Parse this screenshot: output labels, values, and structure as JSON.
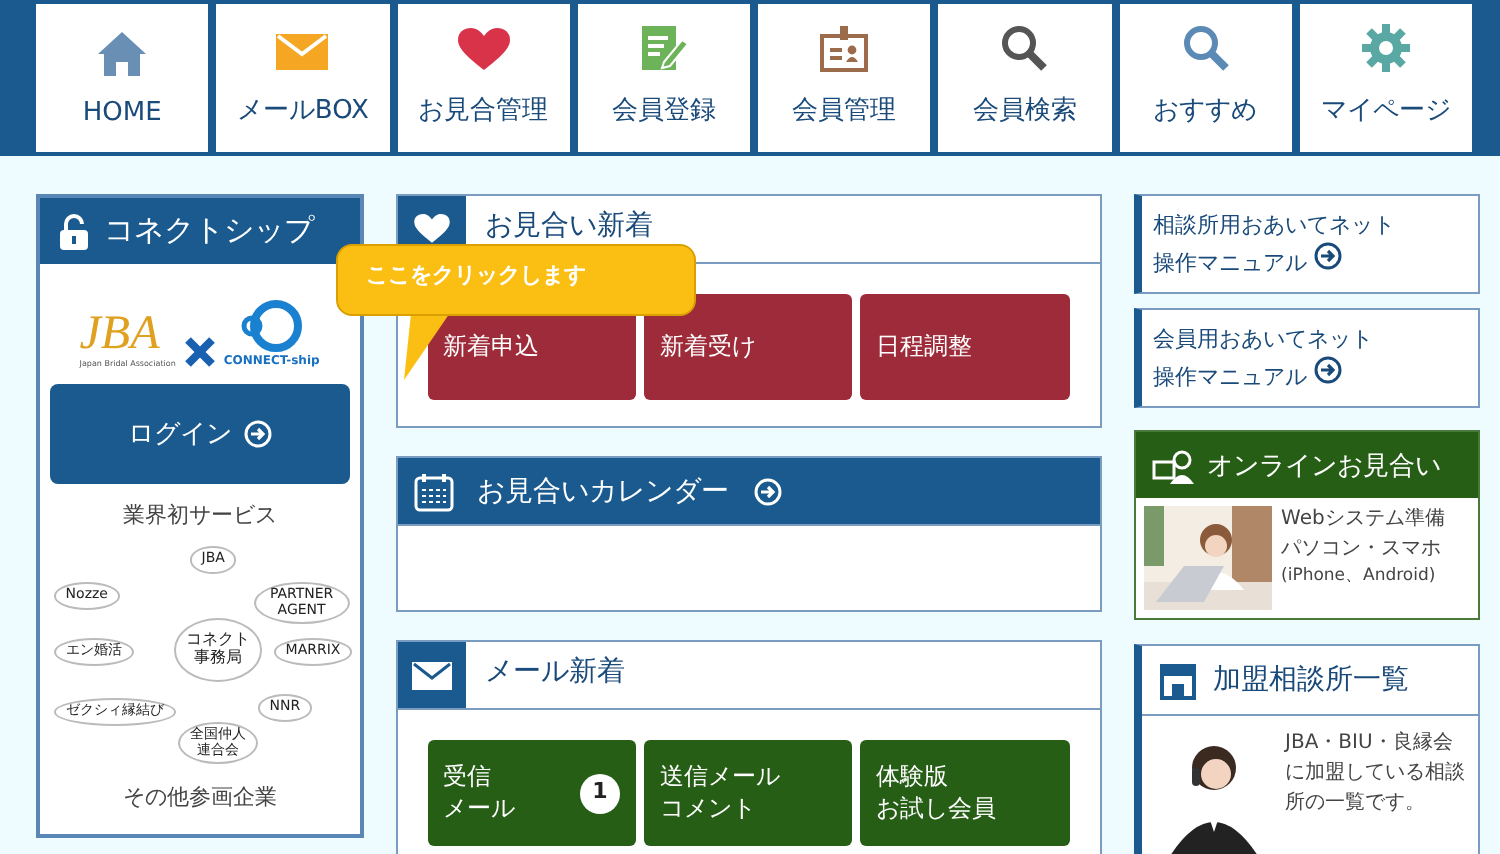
{
  "nav": [
    {
      "label": "HOME"
    },
    {
      "label": "メールBOX"
    },
    {
      "label": "お見合管理"
    },
    {
      "label": "会員登録"
    },
    {
      "label": "会員管理"
    },
    {
      "label": "会員検索"
    },
    {
      "label": "おすすめ"
    },
    {
      "label": "マイページ"
    }
  ],
  "connect_panel": {
    "title": "コネクトシップ",
    "logo_left": "JBA",
    "logo_left_sub": "Japan Bridal Association",
    "logo_right": "CONNECT-ship",
    "login": "ログイン",
    "caption": "業界初サービス",
    "diagram": [
      [
        "JBA"
      ],
      [
        "Nozze"
      ],
      [
        "PARTNER AGENT"
      ],
      [
        "エン婚活"
      ],
      [
        "コネクト",
        "事務局"
      ],
      [
        "MARRIX"
      ],
      [
        "ゼクシィ縁結び"
      ],
      [
        "NNR"
      ],
      [
        "全国仲人",
        "連合会"
      ]
    ],
    "footer": "その他参画企業"
  },
  "callout": {
    "text": "ここをクリックします"
  },
  "panels": [
    {
      "kind": "tab",
      "title": "お見合い新着",
      "buttons": [
        {
          "lines": [
            "新着申込"
          ]
        },
        {
          "lines": [
            "新着受け"
          ]
        },
        {
          "lines": [
            "日程調整"
          ]
        }
      ]
    },
    {
      "kind": "bar",
      "title": "お見合いカレンダー"
    },
    {
      "kind": "tab",
      "title": "メール新着",
      "buttons": [
        {
          "lines": [
            "受信",
            "メール"
          ],
          "badge": "1"
        },
        {
          "lines": [
            "送信メール",
            "コメント"
          ]
        },
        {
          "lines": [
            "体験版",
            "お試し会員"
          ]
        }
      ]
    }
  ],
  "manuals": [
    {
      "lines": [
        "相談所用おあいてネット",
        "操作マニュアル"
      ]
    },
    {
      "lines": [
        "会員用おあいてネット",
        "操作マニュアル"
      ]
    }
  ],
  "online": {
    "title": "オンラインお見合い",
    "lines": [
      "Webシステム準備",
      "パソコン・スマホ",
      "(iPhone、Android)"
    ]
  },
  "agencies": {
    "title": "加盟相談所一覧",
    "text": "JBA・BIU・良縁会に加盟している相談所の一覧です。"
  }
}
